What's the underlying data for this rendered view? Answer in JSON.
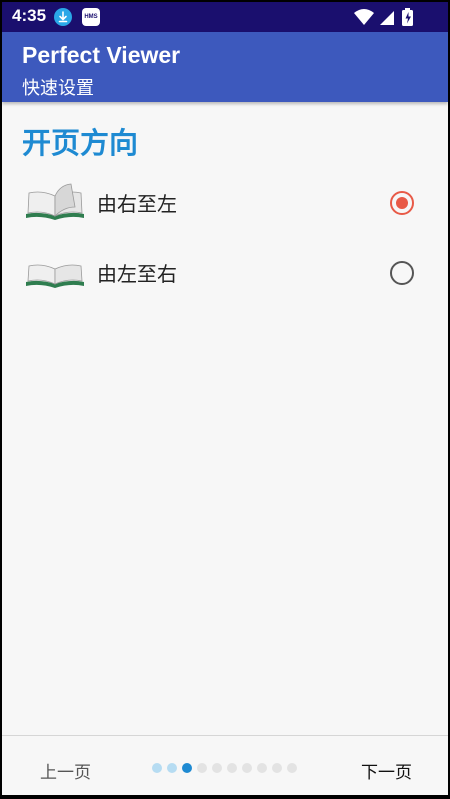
{
  "status_bar": {
    "time": "4:35",
    "icons": [
      "download-icon",
      "hms-icon",
      "wifi-icon",
      "signal-icon",
      "battery-charging-icon"
    ],
    "hms_label": "HMS"
  },
  "app_bar": {
    "title": "Perfect Viewer",
    "subtitle": "快速设置",
    "color": "#3d59bd"
  },
  "section": {
    "heading": "开页方向",
    "heading_color": "#1e8ad2",
    "options": [
      {
        "label": "由右至左",
        "selected": true,
        "icon": "book-open-icon"
      },
      {
        "label": "由左至右",
        "selected": false,
        "icon": "book-open-icon"
      }
    ],
    "radio_selected_color": "#e85a47"
  },
  "bottom_nav": {
    "prev_label": "上一页",
    "next_label": "下一页",
    "page_count": 10,
    "current_page": 3,
    "dot_colors": {
      "visited": "#b6dcf2",
      "current": "#1e8ad2",
      "upcoming": "#e3e3e3"
    }
  }
}
